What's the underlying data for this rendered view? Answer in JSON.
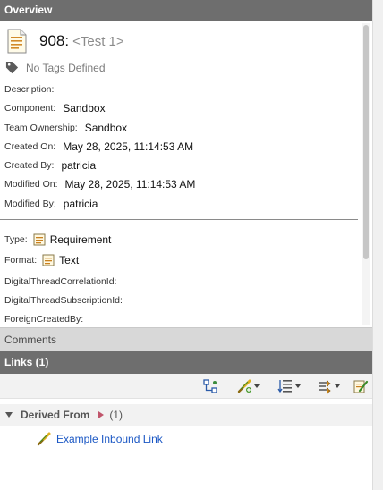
{
  "overview": {
    "header": "Overview",
    "item_id": "908:",
    "item_name": "<Test 1>",
    "tags_text": "No Tags Defined",
    "fields": [
      {
        "label": "Description:",
        "value": ""
      },
      {
        "label": "Component:",
        "value": "Sandbox"
      },
      {
        "label": "Team Ownership:",
        "value": "Sandbox"
      },
      {
        "label": "Created On:",
        "value": "May 28, 2025, 11:14:53 AM"
      },
      {
        "label": "Created By:",
        "value": "patricia"
      },
      {
        "label": "Modified On:",
        "value": "May 28, 2025, 11:14:53 AM"
      },
      {
        "label": "Modified By:",
        "value": "patricia"
      }
    ],
    "type_label": "Type:",
    "type_value": "Requirement",
    "format_label": "Format:",
    "format_value": "Text",
    "extra_fields": [
      {
        "label": "DigitalThreadCorrelationId:"
      },
      {
        "label": "DigitalThreadSubscriptionId:"
      },
      {
        "label": "ForeignCreatedBy:"
      }
    ]
  },
  "comments": {
    "header": "Comments"
  },
  "links": {
    "header": "Links (1)",
    "toolbar": [
      "show-hierarchy",
      "add-link",
      "sort",
      "filter-links",
      "edit"
    ],
    "groups": [
      {
        "name": "Derived From",
        "count": "(1)",
        "items": [
          {
            "text": "Example Inbound Link"
          }
        ]
      }
    ]
  },
  "colors": {
    "header_bg": "#6e6e6e",
    "link_text": "#1a57c4",
    "section_bg": "#d8d8d8"
  }
}
